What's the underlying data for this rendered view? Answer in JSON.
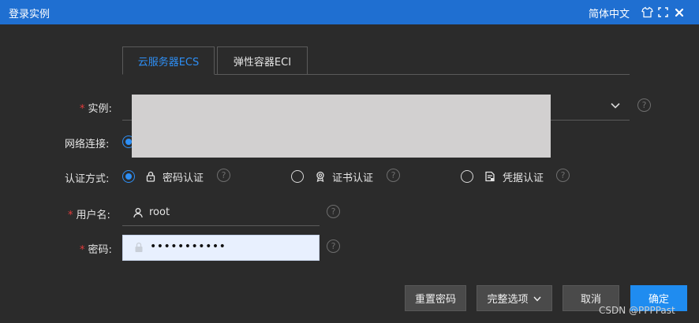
{
  "window": {
    "title": "登录实例",
    "language": "简体中文",
    "icons": [
      "shirt-icon",
      "fullscreen-icon",
      "close-icon"
    ]
  },
  "tabs": [
    {
      "label": "云服务器ECS",
      "active": true
    },
    {
      "label": "弹性容器ECI",
      "active": false
    }
  ],
  "form": {
    "instance_label": "实例:",
    "network_label": "网络连接:",
    "auth_label": "认证方式:",
    "auth_options": [
      {
        "label": "密码认证",
        "icon": "lock-icon",
        "selected": true
      },
      {
        "label": "证书认证",
        "icon": "certificate-icon",
        "selected": false
      },
      {
        "label": "凭据认证",
        "icon": "credential-icon",
        "selected": false
      }
    ],
    "username_label": "用户名:",
    "username_value": "root",
    "password_label": "密码:",
    "password_value": "•••••••••••"
  },
  "buttons": {
    "reset_password": "重置密码",
    "full_options": "完整选项",
    "cancel": "取消",
    "confirm": "确定"
  },
  "watermark": "CSDN @PPPPast",
  "colors": {
    "accent": "#2e8ff5",
    "titlebar": "#1f6fd1",
    "background": "#2b2b2b",
    "required": "#e23b3b"
  }
}
